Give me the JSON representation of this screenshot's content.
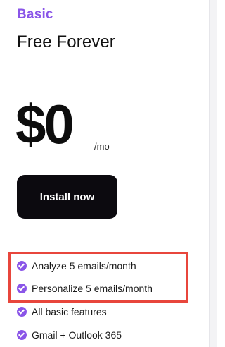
{
  "plan": {
    "tier": "Basic",
    "name": "Free Forever",
    "price": "$0",
    "period": "/mo",
    "cta_label": "Install now"
  },
  "features": [
    {
      "text": "Analyze 5 emails/month",
      "icon": "check-circle-icon",
      "highlighted": true
    },
    {
      "text": "Personalize 5 emails/month",
      "icon": "check-circle-icon",
      "highlighted": true
    },
    {
      "text": "All basic features",
      "icon": "check-circle-icon",
      "highlighted": false
    },
    {
      "text": "Gmail + Outlook 365",
      "icon": "check-circle-icon",
      "highlighted": false
    }
  ],
  "colors": {
    "accent": "#8a55e8",
    "button": "#0c0a0f",
    "highlight_border": "#e8463c"
  }
}
